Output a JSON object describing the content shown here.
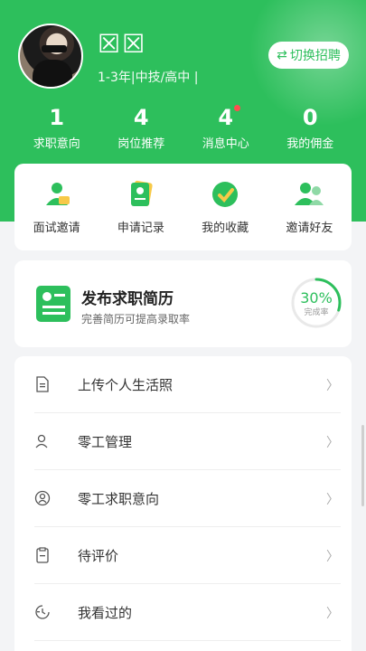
{
  "profile": {
    "name": "☒☒",
    "meta": "1-3年|中技/高中 |",
    "switch_label": "切换招聘"
  },
  "stats": [
    {
      "value": "1",
      "label": "求职意向"
    },
    {
      "value": "4",
      "label": "岗位推荐"
    },
    {
      "value": "4",
      "label": "消息中心"
    },
    {
      "value": "0",
      "label": "我的佣金"
    }
  ],
  "quick_actions": [
    {
      "label": "面试邀请",
      "icon": "interview-invite-icon"
    },
    {
      "label": "申请记录",
      "icon": "application-record-icon"
    },
    {
      "label": "我的收藏",
      "icon": "favorites-icon"
    },
    {
      "label": "邀请好友",
      "icon": "invite-friends-icon"
    }
  ],
  "resume": {
    "title": "发布求职简历",
    "subtitle": "完善简历可提高录取率",
    "progress_label": "30%",
    "progress_caption": "完成率",
    "progress_fraction": 0.3
  },
  "menu": [
    {
      "label": "上传个人生活照",
      "icon": "photo-document-icon"
    },
    {
      "label": "零工管理",
      "icon": "user-icon"
    },
    {
      "label": "零工求职意向",
      "icon": "person-badge-icon"
    },
    {
      "label": "待评价",
      "icon": "clipboard-icon"
    },
    {
      "label": "我看过的",
      "icon": "history-icon"
    }
  ],
  "colors": {
    "brand": "#2dbf5c",
    "badge": "#ff4d4f"
  }
}
